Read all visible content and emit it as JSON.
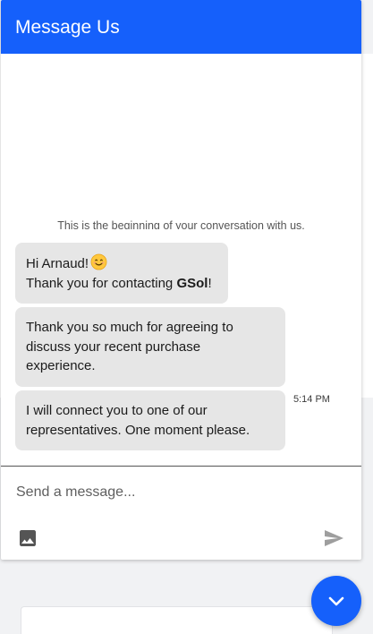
{
  "header": {
    "title": "Message Us"
  },
  "conversation": {
    "start_notice": "This is the beginning of your conversation with us.",
    "messages": [
      {
        "greeting": "Hi Arnaud!",
        "emoji": "smiling-face-emoji",
        "line2_prefix": "Thank you for contacting ",
        "brand": "GSol",
        "line2_suffix": "!"
      },
      {
        "lines": [
          "Thank you so much for agreeing to",
          "discuss your recent purchase",
          "experience."
        ]
      },
      {
        "lines": [
          "I will connect you to one of our",
          "representatives. One moment please."
        ]
      }
    ],
    "timestamp": "5:14 PM"
  },
  "composer": {
    "placeholder": "Send a message...",
    "image_icon": "image-icon",
    "send_icon": "send-icon"
  },
  "fab": {
    "icon": "chevron-down-icon"
  },
  "colors": {
    "accent": "#1560fb",
    "bubble": "#e6e6e6"
  }
}
